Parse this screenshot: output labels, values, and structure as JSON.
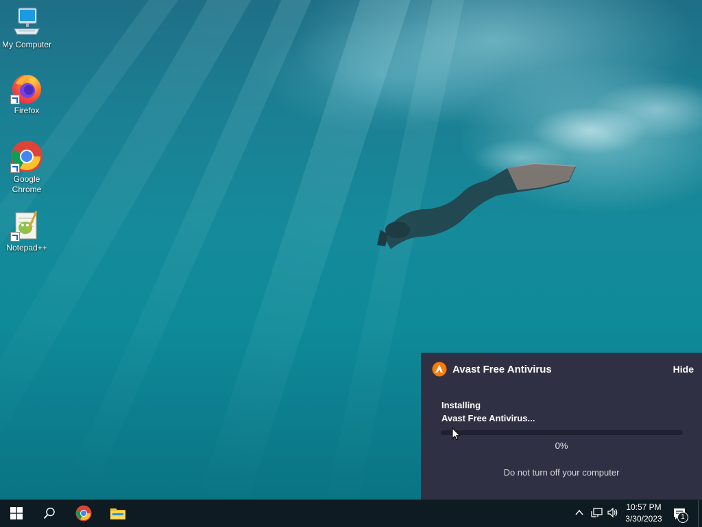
{
  "desktop": {
    "icons": [
      {
        "label": "My Computer",
        "icon": "computer-icon"
      },
      {
        "label": "Firefox",
        "icon": "firefox-icon"
      },
      {
        "label": "Google Chrome",
        "icon": "chrome-icon"
      },
      {
        "label": "Notepad++",
        "icon": "notepad-plus-plus-icon"
      }
    ]
  },
  "avast": {
    "title": "Avast Free Antivirus",
    "hide_label": "Hide",
    "status_line1": "Installing",
    "status_line2": "Avast Free Antivirus...",
    "progress_fraction": 0,
    "progress_text": "0%",
    "note": "Do not turn off your computer",
    "colors": {
      "panel": "#2f3043",
      "accent": "#ff7800"
    }
  },
  "taskbar": {
    "pinned": [
      {
        "name": "start",
        "icon": "windows-logo-icon"
      },
      {
        "name": "search",
        "icon": "search-icon"
      },
      {
        "name": "chrome",
        "icon": "chrome-icon"
      },
      {
        "name": "file-explorer",
        "icon": "folder-icon"
      }
    ],
    "tray": {
      "time": "10:57 PM",
      "date": "3/30/2023",
      "notification_count": "1"
    }
  }
}
